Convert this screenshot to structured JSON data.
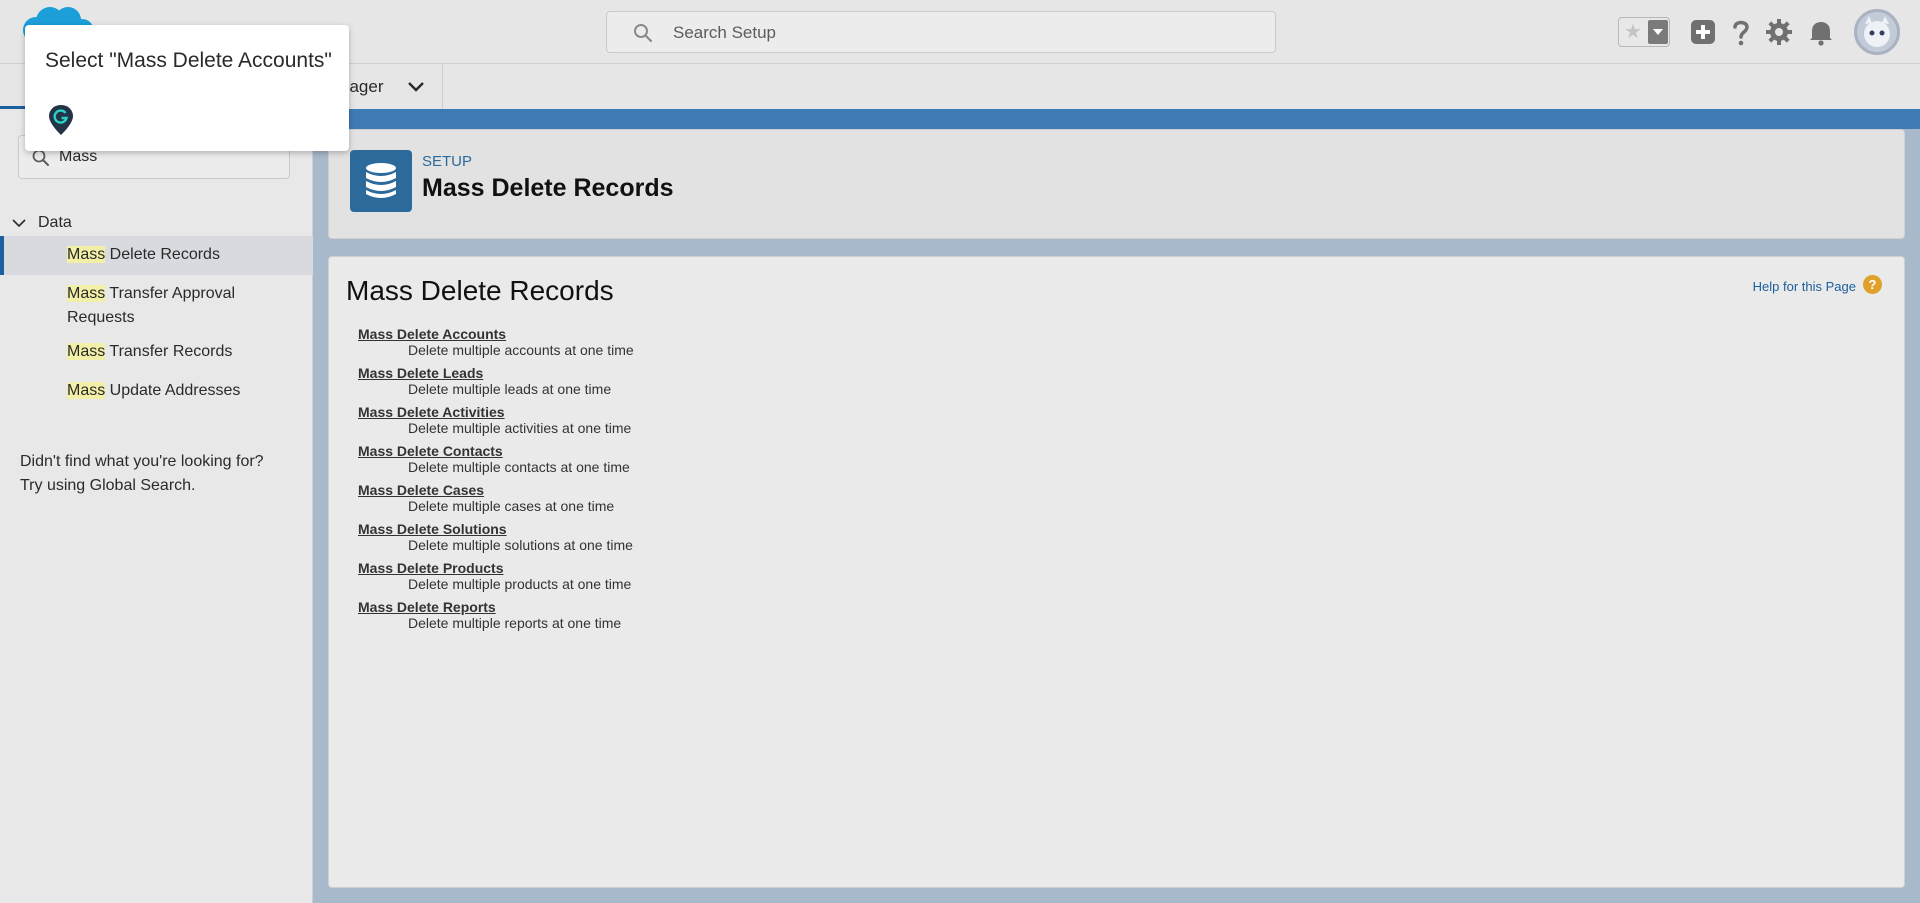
{
  "header": {
    "search_placeholder": "Search Setup"
  },
  "tabs": {
    "partial_label": "nager"
  },
  "sidebar": {
    "quickfind_value": "Mass",
    "category": "Data",
    "items": [
      {
        "highlight": "Mass",
        "rest": " Delete Records"
      },
      {
        "highlight": "Mass",
        "rest": " Transfer Approval Requests"
      },
      {
        "highlight": "Mass",
        "rest": " Transfer Records"
      },
      {
        "highlight": "Mass",
        "rest": " Update Addresses"
      }
    ],
    "not_found_line1": "Didn't find what you're looking for?",
    "not_found_line2": "Try using Global Search."
  },
  "guide": {
    "title": "Select \"Mass Delete Accounts\""
  },
  "page_header": {
    "eyebrow": "SETUP",
    "title": "Mass Delete Records"
  },
  "content": {
    "title": "Mass Delete Records",
    "help_link": "Help for this Page",
    "help_icon": "?",
    "items": [
      {
        "label": "Mass Delete Accounts",
        "desc": "Delete multiple accounts at one time"
      },
      {
        "label": "Mass Delete Leads",
        "desc": "Delete multiple leads at one time"
      },
      {
        "label": "Mass Delete Activities",
        "desc": "Delete multiple activities at one time"
      },
      {
        "label": "Mass Delete Contacts",
        "desc": "Delete multiple contacts at one time"
      },
      {
        "label": "Mass Delete Cases",
        "desc": "Delete multiple cases at one time"
      },
      {
        "label": "Mass Delete Solutions",
        "desc": "Delete multiple solutions at one time"
      },
      {
        "label": "Mass Delete Products",
        "desc": "Delete multiple products at one time"
      },
      {
        "label": "Mass Delete Reports",
        "desc": "Delete multiple reports at one time"
      }
    ]
  },
  "icons": {
    "logo": "salesforce-cloud-logo",
    "search": "search-icon",
    "favorite": "star-icon",
    "add": "plus-icon",
    "help": "question-icon",
    "settings": "gear-icon",
    "notifications": "bell-icon",
    "avatar": "user-avatar",
    "guide_marker": "guide-pin-icon",
    "page_icon": "database-icon"
  },
  "colors": {
    "accent": "#1b5f9e",
    "page_icon_bg": "#2b6a9a",
    "highlight": "#f2f0a6",
    "help_icon": "#e0a12a"
  }
}
